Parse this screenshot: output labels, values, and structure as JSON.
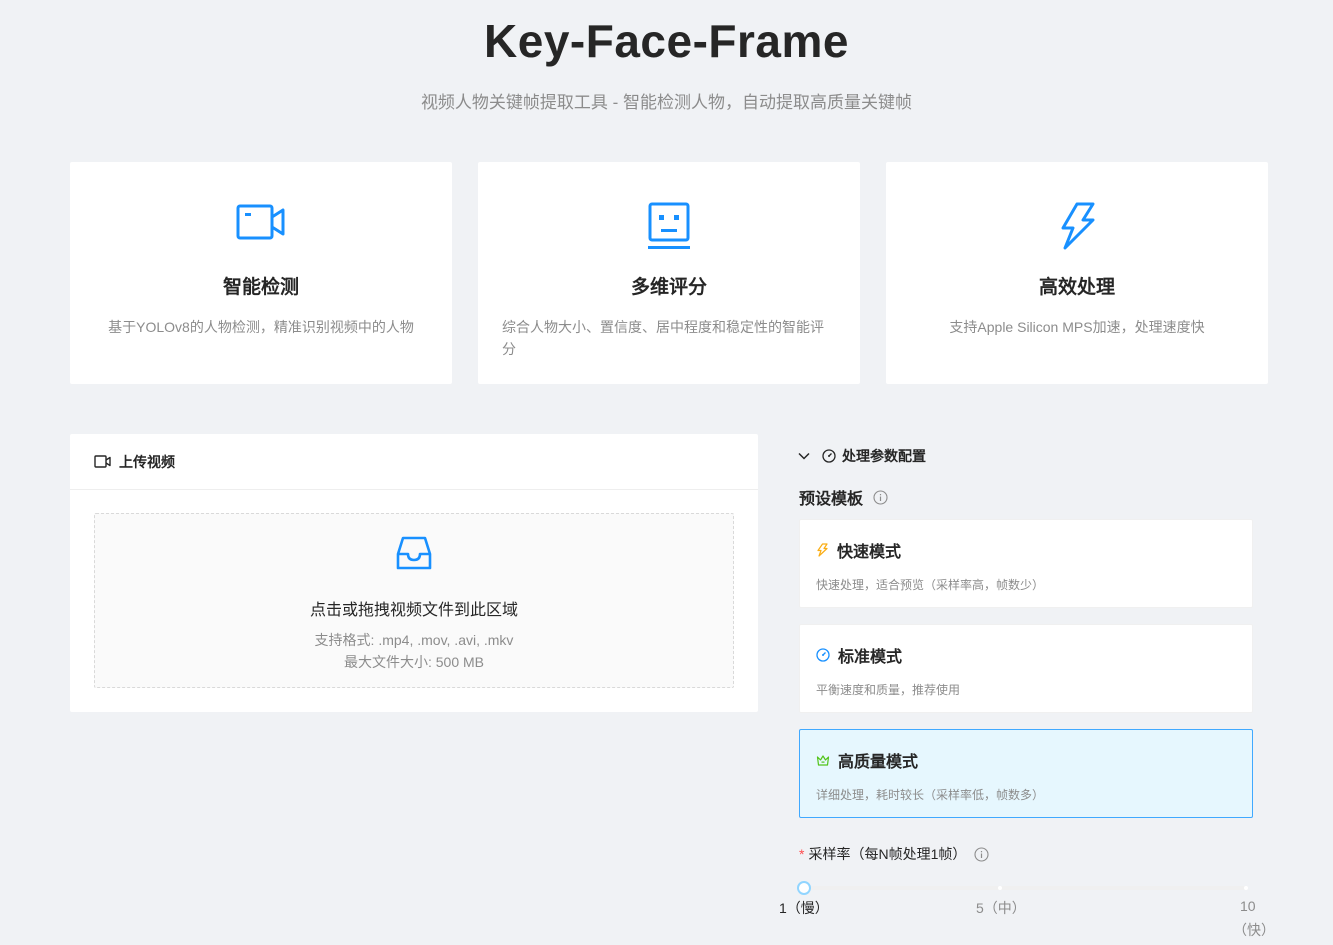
{
  "header": {
    "title": "Key-Face-Frame",
    "subtitle": "视频人物关键帧提取工具 - 智能检测人物，自动提取高质量关键帧"
  },
  "features": [
    {
      "icon": "video-camera-icon",
      "title": "智能检测",
      "desc": "基于YOLOv8的人物检测，精准识别视频中的人物"
    },
    {
      "icon": "robot-face-icon",
      "title": "多维评分",
      "desc": "综合人物大小、置信度、居中程度和稳定性的智能评分"
    },
    {
      "icon": "thunderbolt-icon",
      "title": "高效处理",
      "desc": "支持Apple Silicon MPS加速，处理速度快"
    }
  ],
  "upload": {
    "title": "上传视频",
    "drop_text": "点击或拖拽视频文件到此区域",
    "formats": "支持格式: .mp4, .mov, .avi, .mkv",
    "max_size": "最大文件大小: 500 MB"
  },
  "config": {
    "title": "处理参数配置",
    "preset_label": "预设模板",
    "modes": [
      {
        "icon": "thunderbolt-icon",
        "title": "快速模式",
        "desc": "快速处理，适合预览（采样率高，帧数少）",
        "active": false
      },
      {
        "icon": "dashboard-icon",
        "title": "标准模式",
        "desc": "平衡速度和质量，推荐使用",
        "active": false
      },
      {
        "icon": "crown-icon",
        "title": "高质量模式",
        "desc": "详细处理，耗时较长（采样率低，帧数多）",
        "active": true
      }
    ],
    "sample_rate": {
      "required_mark": "*",
      "label": "采样率（每N帧处理1帧）",
      "value": 1,
      "min": 1,
      "max": 10,
      "marks": [
        {
          "value": 1,
          "label": "1（慢）"
        },
        {
          "value": 5,
          "label": "5（中）"
        },
        {
          "value": 10,
          "label_top": "10",
          "label_bottom": "（快）"
        }
      ]
    }
  },
  "colors": {
    "primary": "#1890ff",
    "active_bg": "#e6f7fe",
    "active_border": "#40a9ff",
    "fast_icon": "#faad14",
    "quality_icon": "#52c41a",
    "required": "#ff4d4f"
  }
}
